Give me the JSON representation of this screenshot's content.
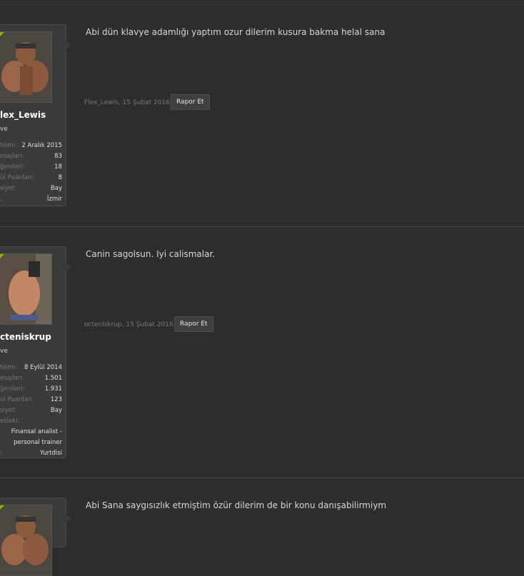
{
  "posts": [
    {
      "username": "lex_Lewis",
      "usertitle": "ve",
      "stats": [
        {
          "label": "tılımı:",
          "value": "2 Aralık 2015"
        },
        {
          "label": "esajları:",
          "value": "83"
        },
        {
          "label": "ğenileri:",
          "value": "18"
        },
        {
          "label": "ül Puanları:",
          "value": "8"
        },
        {
          "label": "siyet:",
          "value": "Bay"
        },
        {
          "label": ":",
          "value": "İzmir"
        }
      ],
      "message": "Abi dün klavye adamlığı yaptım ozur dilerim kusura bakma helal sana",
      "meta": "Flex_Lewis, 15 Şubat 2016",
      "report_label": "Rapor Et"
    },
    {
      "username": "cteniskrup",
      "usertitle": "ve",
      "stats": [
        {
          "label": "tılımı:",
          "value": "8 Eylül 2014"
        },
        {
          "label": "esajları:",
          "value": "1.501"
        },
        {
          "label": "ğenileri:",
          "value": "1.931"
        },
        {
          "label": "ül Puanları:",
          "value": "123"
        },
        {
          "label": "siyet:",
          "value": "Bay"
        },
        {
          "label": "esleki:",
          "value": ""
        },
        {
          "label": "",
          "value": "Finansal analist -"
        },
        {
          "label": "",
          "value": "personal trainer"
        },
        {
          "label": ":",
          "value": "Yurtdisi"
        }
      ],
      "message": "Canin sagolsun. Iyi calismalar.",
      "meta": "octeniskrup, 15 Şubat 2016",
      "report_label": "Rapor Et"
    },
    {
      "message": "Abi Sana saygısızlık etmiştim özür dilerim de bir konu danışabilirmiym"
    }
  ]
}
